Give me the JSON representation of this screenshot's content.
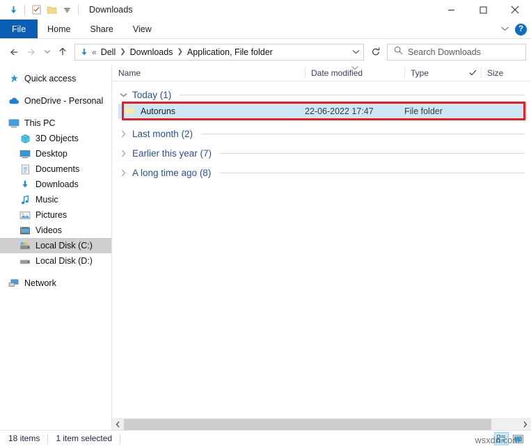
{
  "window": {
    "title": "Downloads",
    "quick_access_icons": [
      "downloads-arrow-icon",
      "properties-icon",
      "new-folder-icon",
      "customize-chevron-icon"
    ],
    "controls": {
      "minimize": "minimize-icon",
      "maximize": "maximize-icon",
      "close": "close-icon"
    }
  },
  "ribbon": {
    "tabs": [
      {
        "label": "File",
        "active": true
      },
      {
        "label": "Home",
        "active": false
      },
      {
        "label": "Share",
        "active": false
      },
      {
        "label": "View",
        "active": false
      }
    ],
    "expand_label": "chevron-down-icon",
    "help_label": "?"
  },
  "address": {
    "back": "back-arrow-icon",
    "forward": "forward-arrow-icon",
    "recent": "recent-locations-chevron",
    "up": "up-arrow-icon",
    "location_icon": "downloads-arrow-icon",
    "overflow": "«",
    "crumbs": [
      "Dell",
      "Downloads",
      "Application, File folder"
    ],
    "dropdown": "chevron-down-icon",
    "refresh": "refresh-icon"
  },
  "search": {
    "icon": "search-icon",
    "placeholder": "Search Downloads",
    "value": ""
  },
  "sidebar": {
    "items": [
      {
        "label": "Quick access",
        "icon": "star-pin-icon",
        "indent": false,
        "selected": false,
        "spacer": false
      },
      {
        "label": "OneDrive - Personal",
        "icon": "cloud-icon",
        "indent": false,
        "selected": false,
        "spacer": true
      },
      {
        "label": "This PC",
        "icon": "monitor-icon",
        "indent": false,
        "selected": false,
        "spacer": true
      },
      {
        "label": "3D Objects",
        "icon": "cube-icon",
        "indent": true,
        "selected": false,
        "spacer": false
      },
      {
        "label": "Desktop",
        "icon": "desktop-icon",
        "indent": true,
        "selected": false,
        "spacer": false
      },
      {
        "label": "Documents",
        "icon": "document-icon",
        "indent": true,
        "selected": false,
        "spacer": false
      },
      {
        "label": "Downloads",
        "icon": "downloads-arrow-icon",
        "indent": true,
        "selected": false,
        "spacer": false
      },
      {
        "label": "Music",
        "icon": "music-note-icon",
        "indent": true,
        "selected": false,
        "spacer": false
      },
      {
        "label": "Pictures",
        "icon": "picture-icon",
        "indent": true,
        "selected": false,
        "spacer": false
      },
      {
        "label": "Videos",
        "icon": "video-icon",
        "indent": true,
        "selected": false,
        "spacer": false
      },
      {
        "label": "Local Disk (C:)",
        "icon": "system-drive-icon",
        "indent": true,
        "selected": true,
        "spacer": false
      },
      {
        "label": "Local Disk (D:)",
        "icon": "drive-icon",
        "indent": true,
        "selected": false,
        "spacer": false
      },
      {
        "label": "Network",
        "icon": "network-icon",
        "indent": false,
        "selected": false,
        "spacer": true
      }
    ]
  },
  "columns": {
    "name": "Name",
    "date_modified": "Date modified",
    "type": "Type",
    "size": "Size",
    "sort_indicator": "chevron-down-icon",
    "size_check": "check-icon"
  },
  "filelist": {
    "groups": [
      {
        "label": "Today (1)",
        "expanded": true,
        "rows": [
          {
            "name": "Autoruns",
            "date": "22-06-2022 17:47",
            "type": "File folder",
            "size": "",
            "icon": "folder-icon",
            "selected": true,
            "highlighted": true
          }
        ]
      },
      {
        "label": "Last month (2)",
        "expanded": false,
        "rows": []
      },
      {
        "label": "Earlier this year (7)",
        "expanded": false,
        "rows": []
      },
      {
        "label": "A long time ago (8)",
        "expanded": false,
        "rows": []
      }
    ]
  },
  "status": {
    "item_count": "18 items",
    "selection": "1 item selected",
    "view_details": "details-view-icon",
    "view_icons": "large-icons-view-icon"
  },
  "watermark": "wsxdn.com",
  "colors": {
    "accent": "#0a5fb4",
    "selection": "#cce8f7",
    "highlight_box": "#ee1c1c",
    "group_label": "#26509e"
  }
}
